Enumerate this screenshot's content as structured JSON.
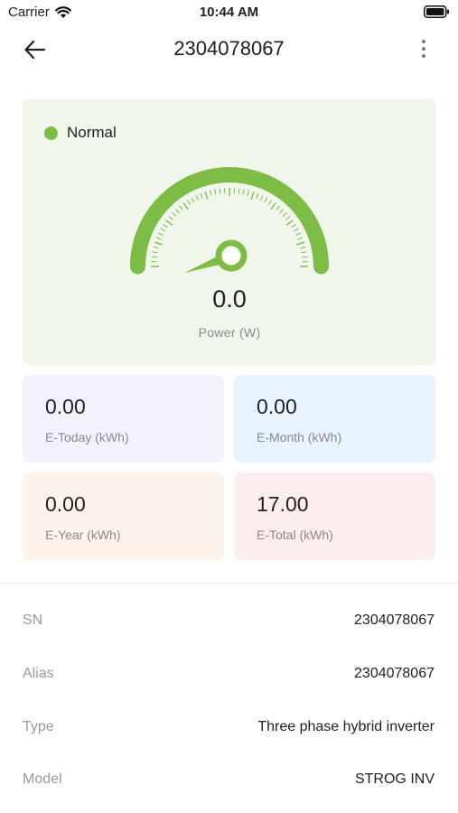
{
  "status_bar": {
    "carrier": "Carrier",
    "time": "10:44 AM"
  },
  "nav": {
    "title": "2304078067"
  },
  "gauge": {
    "status": "Normal",
    "status_color": "#7dbd45",
    "value": "0.0",
    "label": "Power  (W)",
    "level_fraction": 0,
    "accent_color": "#7dbd45"
  },
  "stats": {
    "today": {
      "value": "0.00",
      "label": "E-Today (kWh)"
    },
    "month": {
      "value": "0.00",
      "label": "E-Month (kWh)"
    },
    "year": {
      "value": "0.00",
      "label": "E-Year (kWh)"
    },
    "total": {
      "value": "17.00",
      "label": "E-Total (kWh)"
    }
  },
  "info": [
    {
      "label": "SN",
      "value": "2304078067"
    },
    {
      "label": "Alias",
      "value": "2304078067"
    },
    {
      "label": "Type",
      "value": "Three phase hybrid inverter"
    },
    {
      "label": "Model",
      "value": "STROG INV"
    }
  ]
}
